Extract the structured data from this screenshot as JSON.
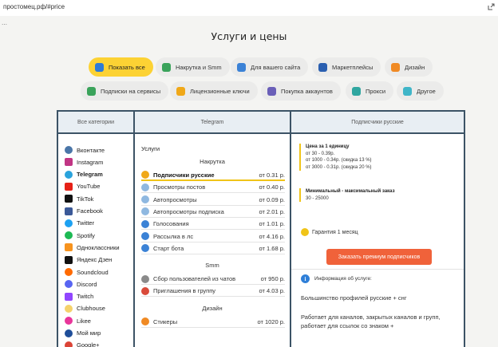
{
  "browser": {
    "url": "простомец.рф/#price"
  },
  "page": {
    "title": "Услуги и цены"
  },
  "filters": [
    {
      "label": "Показать все",
      "icon": "share-icon",
      "color": "#2e7bd6",
      "active": true
    },
    {
      "label": "Накрутка и Smm",
      "icon": "chart-icon",
      "color": "#3aa35b"
    },
    {
      "label": "Для вашего сайта",
      "icon": "globe-icon",
      "color": "#3b82d6"
    },
    {
      "label": "Маркетплейсы",
      "icon": "store-icon",
      "color": "#2a5fb0"
    },
    {
      "label": "Дизайн",
      "icon": "brush-icon",
      "color": "#f08a24"
    },
    {
      "label": "Подписки на сервисы",
      "icon": "check-icon",
      "color": "#3aa35b"
    },
    {
      "label": "Лицензионные ключи",
      "icon": "key-icon",
      "color": "#f0a818"
    },
    {
      "label": "Покупка аккаунтов",
      "icon": "user-icon",
      "color": "#6a5fb8"
    },
    {
      "label": "Прокси",
      "icon": "proxy-icon",
      "color": "#2fa6a0"
    },
    {
      "label": "Другое",
      "icon": "dots-icon",
      "color": "#3fb5c8"
    }
  ],
  "categories": {
    "header": "Все категории",
    "items": [
      {
        "label": "Вконтакте",
        "color": "#4a76a8"
      },
      {
        "label": "Instagram",
        "color": "#c13584",
        "square": true
      },
      {
        "label": "Telegram",
        "color": "#2aa3dc",
        "selected": true
      },
      {
        "label": "YouTube",
        "color": "#e62117",
        "square": true
      },
      {
        "label": "TikTok",
        "color": "#111111",
        "square": true
      },
      {
        "label": "Facebook",
        "color": "#3b5998",
        "square": true
      },
      {
        "label": "Twitter",
        "color": "#1da1f2"
      },
      {
        "label": "Spotify",
        "color": "#1db954"
      },
      {
        "label": "Одноклассники",
        "color": "#f7931e",
        "square": true
      },
      {
        "label": "Яндекс Дзен",
        "color": "#111111",
        "square": true
      },
      {
        "label": "Soundcloud",
        "color": "#ff6a00"
      },
      {
        "label": "Discord",
        "color": "#5865f2"
      },
      {
        "label": "Twitch",
        "color": "#9146ff",
        "square": true
      },
      {
        "label": "Clubhouse",
        "color": "#f5d26b"
      },
      {
        "label": "Likee",
        "color": "#e8359a"
      },
      {
        "label": "Мой мир",
        "color": "#1f4e99"
      },
      {
        "label": "Google+",
        "color": "#db4437"
      }
    ]
  },
  "services": {
    "header": "Telegram",
    "group_label": "Услуги",
    "sections": [
      {
        "title": "Накрутка",
        "rows": [
          {
            "name": "Подписчики русские",
            "price": "от 0.31 р.",
            "icon": "users-icon",
            "color": "#f0a818",
            "selected": true
          },
          {
            "name": "Просмотры постов",
            "price": "от 0.40 р.",
            "icon": "eye-icon",
            "color": "#8fb8e0"
          },
          {
            "name": "Автопросмотры",
            "price": "от 0.09 р.",
            "icon": "eye-icon",
            "color": "#8fb8e0"
          },
          {
            "name": "Автопросмотры подписка",
            "price": "от 2.01 р.",
            "icon": "eye-icon",
            "color": "#8fb8e0"
          },
          {
            "name": "Голосования",
            "price": "от 1.01 р.",
            "icon": "vote-icon",
            "color": "#3b82d6"
          },
          {
            "name": "Рассылка в лс",
            "price": "от 4.16 р.",
            "icon": "mail-icon",
            "color": "#3b82d6"
          },
          {
            "name": "Старт бота",
            "price": "от 1.68 р.",
            "icon": "bot-icon",
            "color": "#3b82d6"
          }
        ]
      },
      {
        "title": "Smm",
        "rows": [
          {
            "name": "Сбор пользователей из чатов",
            "price": "от 950 р.",
            "icon": "search-icon",
            "color": "#8a8a8a"
          },
          {
            "name": "Приглашения в группу",
            "price": "от 4.03 р.",
            "icon": "invite-icon",
            "color": "#d94a3a"
          }
        ]
      },
      {
        "title": "Дизайн",
        "rows": [
          {
            "name": "Стикеры",
            "price": "от 1020 р.",
            "icon": "fire-icon",
            "color": "#f08a24"
          }
        ]
      }
    ]
  },
  "detail": {
    "header": "Подписчики русские",
    "price_title": "Цена за 1 единицу",
    "price_lines": [
      "от 30 - 0.39р.",
      "от 1000 - 0.34р. (скидка 13 %)",
      "от 3000 - 0.31р. (скидка 20 %)"
    ],
    "order_title": "Минимальный - максимальный заказ",
    "order_range": "30 - 25000",
    "guarantee": "Гарантия 1 месяц",
    "order_button": "Заказать премиум подписчиков",
    "info_label": "Информация об услуге:",
    "desc1": "Большинство профилей русские + снг",
    "desc2": "Работает для каналов, закрытых каналов и групп, работает для ссылок со знаком +"
  }
}
